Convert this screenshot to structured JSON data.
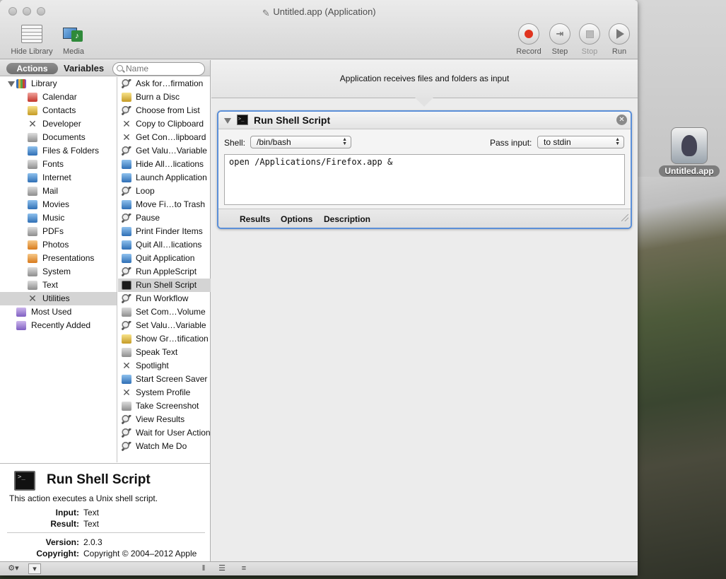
{
  "window": {
    "title": "Untitled.app (Application)"
  },
  "toolbar": {
    "hide_library": "Hide Library",
    "media": "Media",
    "record": "Record",
    "step": "Step",
    "stop": "Stop",
    "run": "Run"
  },
  "library": {
    "actions_tab": "Actions",
    "variables_tab": "Variables",
    "search_placeholder": "Name",
    "categories": [
      {
        "label": "Library",
        "icon": "library-icon"
      },
      {
        "label": "Calendar",
        "icon": "calendar-icon"
      },
      {
        "label": "Contacts",
        "icon": "contacts-icon"
      },
      {
        "label": "Developer",
        "icon": "developer-icon"
      },
      {
        "label": "Documents",
        "icon": "documents-icon"
      },
      {
        "label": "Files & Folders",
        "icon": "files-folders-icon"
      },
      {
        "label": "Fonts",
        "icon": "fonts-icon"
      },
      {
        "label": "Internet",
        "icon": "internet-icon"
      },
      {
        "label": "Mail",
        "icon": "mail-icon"
      },
      {
        "label": "Movies",
        "icon": "movies-icon"
      },
      {
        "label": "Music",
        "icon": "music-icon"
      },
      {
        "label": "PDFs",
        "icon": "pdfs-icon"
      },
      {
        "label": "Photos",
        "icon": "photos-icon"
      },
      {
        "label": "Presentations",
        "icon": "presentations-icon"
      },
      {
        "label": "System",
        "icon": "system-icon"
      },
      {
        "label": "Text",
        "icon": "text-icon"
      },
      {
        "label": "Utilities",
        "icon": "utilities-icon",
        "selected": true
      },
      {
        "label": "Most Used",
        "icon": "smart-folder-icon"
      },
      {
        "label": "Recently Added",
        "icon": "smart-folder-icon"
      }
    ],
    "actions": [
      {
        "label": "Ask for…firmation",
        "icon": "automator-icon"
      },
      {
        "label": "Burn a Disc",
        "icon": "burn-icon"
      },
      {
        "label": "Choose from List",
        "icon": "automator-icon"
      },
      {
        "label": "Copy to Clipboard",
        "icon": "utilities-icon"
      },
      {
        "label": "Get Con…lipboard",
        "icon": "utilities-icon"
      },
      {
        "label": "Get Valu…Variable",
        "icon": "automator-icon"
      },
      {
        "label": "Hide All…lications",
        "icon": "finder-icon"
      },
      {
        "label": "Launch Application",
        "icon": "finder-icon"
      },
      {
        "label": "Loop",
        "icon": "automator-icon"
      },
      {
        "label": "Move Fi…to Trash",
        "icon": "finder-icon"
      },
      {
        "label": "Pause",
        "icon": "automator-icon"
      },
      {
        "label": "Print Finder Items",
        "icon": "finder-icon"
      },
      {
        "label": "Quit All…lications",
        "icon": "finder-icon"
      },
      {
        "label": "Quit Application",
        "icon": "finder-icon"
      },
      {
        "label": "Run AppleScript",
        "icon": "automator-icon"
      },
      {
        "label": "Run Shell Script",
        "icon": "terminal-icon",
        "selected": true
      },
      {
        "label": "Run Workflow",
        "icon": "automator-icon"
      },
      {
        "label": "Set Com…Volume",
        "icon": "system-icon"
      },
      {
        "label": "Set Valu…Variable",
        "icon": "automator-icon"
      },
      {
        "label": "Show Gr…tification",
        "icon": "notification-icon"
      },
      {
        "label": "Speak Text",
        "icon": "speak-icon"
      },
      {
        "label": "Spotlight",
        "icon": "utilities-icon"
      },
      {
        "label": "Start Screen Saver",
        "icon": "screensaver-icon"
      },
      {
        "label": "System Profile",
        "icon": "utilities-icon"
      },
      {
        "label": "Take Screenshot",
        "icon": "screenshot-icon"
      },
      {
        "label": "View Results",
        "icon": "automator-icon"
      },
      {
        "label": "Wait for User Action",
        "icon": "automator-icon"
      },
      {
        "label": "Watch Me Do",
        "icon": "automator-icon"
      }
    ]
  },
  "description": {
    "title": "Run Shell Script",
    "text": "This action executes a Unix shell script.",
    "input_label": "Input:",
    "input_value": "Text",
    "result_label": "Result:",
    "result_value": "Text",
    "version_label": "Version:",
    "version_value": "2.0.3",
    "copyright_label": "Copyright:",
    "copyright_value": "Copyright © 2004–2012 Apple"
  },
  "workflow": {
    "header": "Application receives files and folders as input",
    "action": {
      "title": "Run Shell Script",
      "shell_label": "Shell:",
      "shell_value": "/bin/bash",
      "pass_input_label": "Pass input:",
      "pass_input_value": "to stdin",
      "script": "open /Applications/Firefox.app &",
      "footer_tabs": [
        "Results",
        "Options",
        "Description"
      ]
    }
  },
  "desktop": {
    "icon_label": "Untitled.app"
  }
}
